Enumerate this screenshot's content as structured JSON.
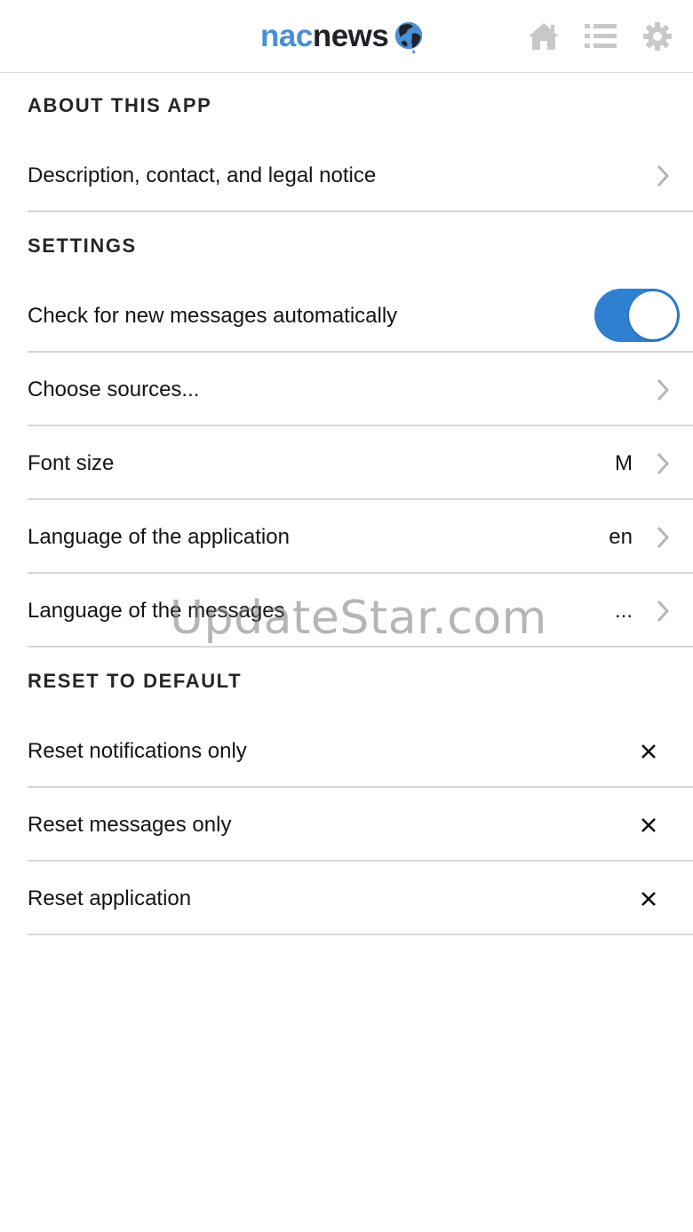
{
  "header": {
    "brand_part1": "nac",
    "brand_part2": "news",
    "brand_logo_icon": "globe-icon",
    "icons": [
      "home-icon",
      "list-icon",
      "gear-icon"
    ],
    "icon_color": "#c8c8c8"
  },
  "sections": {
    "about": {
      "title": "ABOUT THIS APP",
      "rows": [
        {
          "label": "Description, contact, and legal notice"
        }
      ]
    },
    "settings": {
      "title": "SETTINGS",
      "auto_check": {
        "label": "Check for new messages automatically",
        "enabled": true
      },
      "choose_sources": {
        "label": "Choose sources..."
      },
      "font_size": {
        "label": "Font size",
        "value": "M"
      },
      "app_language": {
        "label": "Language of the application",
        "value": "en"
      },
      "message_language": {
        "label": "Language of the messages",
        "value": "..."
      }
    },
    "reset": {
      "title": "RESET TO DEFAULT",
      "notifications": {
        "label": "Reset notifications only"
      },
      "messages": {
        "label": "Reset messages only"
      },
      "application": {
        "label": "Reset application"
      }
    }
  },
  "watermark": "UpdateStar.com",
  "colors": {
    "accent": "#2f80d0",
    "brand_blue": "#4a8fd3",
    "divider": "#d6d6d6"
  }
}
